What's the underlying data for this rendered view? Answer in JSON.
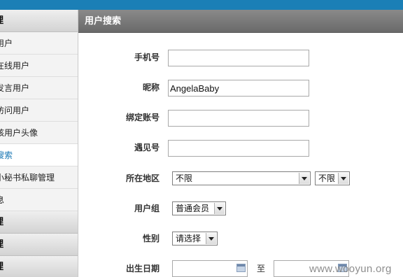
{
  "sidebar": {
    "items": [
      {
        "label": "理",
        "type": "head"
      },
      {
        "label": "用户",
        "type": "link"
      },
      {
        "label": "在线用户",
        "type": "link"
      },
      {
        "label": "发言用户",
        "type": "link"
      },
      {
        "label": "访问用户",
        "type": "link"
      },
      {
        "label": "核用户头像",
        "type": "link"
      },
      {
        "label": "搜索",
        "type": "link",
        "active": true
      },
      {
        "label": "小秘书私聊管理",
        "type": "link"
      },
      {
        "label": "息",
        "type": "link"
      },
      {
        "label": "理",
        "type": "head"
      },
      {
        "label": "理",
        "type": "head"
      },
      {
        "label": "理",
        "type": "head"
      }
    ]
  },
  "panel": {
    "title": "用户搜索"
  },
  "form": {
    "phone": {
      "label": "手机号",
      "value": ""
    },
    "nickname": {
      "label": "昵称",
      "value": "AngelaBaby"
    },
    "bound_account": {
      "label": "绑定账号",
      "value": ""
    },
    "yujian_id": {
      "label": "遇见号",
      "value": ""
    },
    "region": {
      "label": "所在地区",
      "province": "不限",
      "city": "不限"
    },
    "user_group": {
      "label": "用户组",
      "value": "普通会员"
    },
    "gender": {
      "label": "性别",
      "value": "请选择"
    },
    "birthdate": {
      "label": "出生日期",
      "separator": "至"
    }
  },
  "watermark": "www.wooyun.org",
  "colors": {
    "topbar": "#1b7fb6",
    "active_link": "#1a78b4",
    "panel_header": "#777777"
  }
}
